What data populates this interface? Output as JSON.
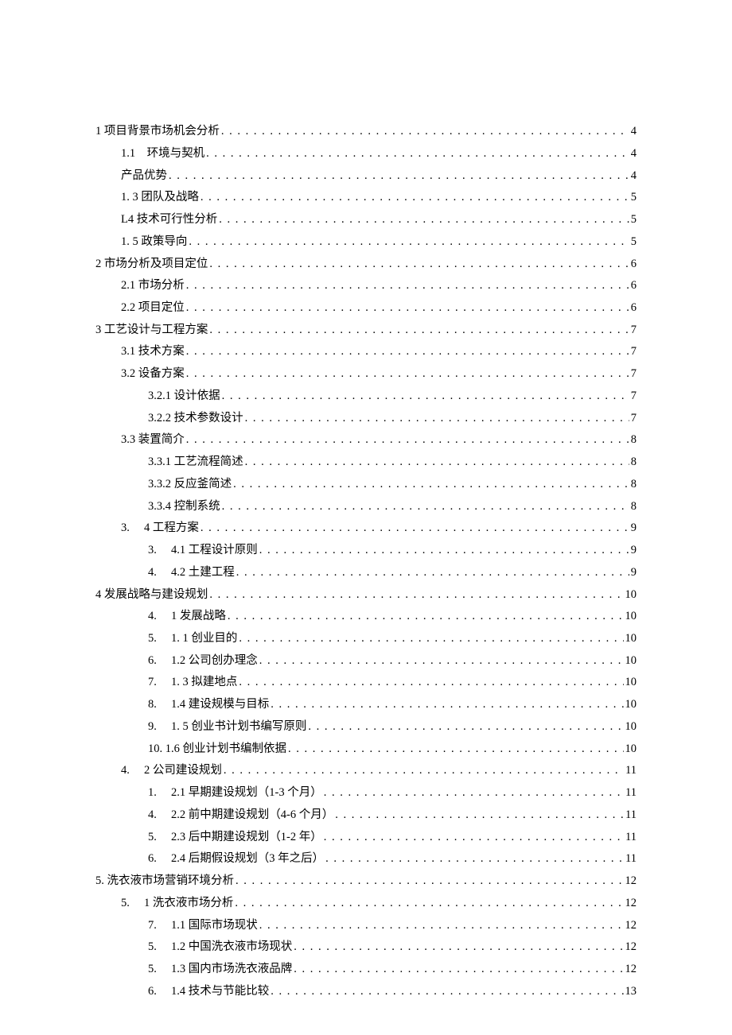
{
  "toc": [
    {
      "indent": 0,
      "label": "1 项目背景市场机会分析",
      "page": "4"
    },
    {
      "indent": 1,
      "label": "1.1　环境与契机",
      "page": "4"
    },
    {
      "indent": 1,
      "label": "产品优势",
      "page": "4"
    },
    {
      "indent": 1,
      "label": "1. 3 团队及战略",
      "page": "5"
    },
    {
      "indent": 1,
      "label": "L4 技术可行性分析",
      "page": "5"
    },
    {
      "indent": 1,
      "label": "1. 5 政策导向",
      "page": "5"
    },
    {
      "indent": 0,
      "label": "2 市场分析及项目定位",
      "page": "6"
    },
    {
      "indent": 1,
      "label": "2.1 市场分析",
      "page": "6"
    },
    {
      "indent": 1,
      "label": "2.2 项目定位",
      "page": "6"
    },
    {
      "indent": 0,
      "label": "3 工艺设计与工程方案",
      "page": "7"
    },
    {
      "indent": 1,
      "label": "3.1 技术方案",
      "page": "7"
    },
    {
      "indent": 1,
      "label": "3.2 设备方案",
      "page": "7"
    },
    {
      "indent": 2,
      "label": "3.2.1 设计依据",
      "page": "7"
    },
    {
      "indent": 2,
      "label": "3.2.2 技术参数设计",
      "page": "7"
    },
    {
      "indent": 1,
      "label": "3.3 装置简介",
      "page": "8"
    },
    {
      "indent": 2,
      "label": "3.3.1 工艺流程简述",
      "page": "8"
    },
    {
      "indent": 2,
      "label": "3.3.2 反应釜简述",
      "page": "8"
    },
    {
      "indent": 2,
      "label": "3.3.4 控制系统",
      "page": "8"
    },
    {
      "indent": 1,
      "label": "3.  4 工程方案",
      "page": "9"
    },
    {
      "indent": 2,
      "label": "3.  4.1 工程设计原则",
      "page": "9"
    },
    {
      "indent": 2,
      "label": "4.  4.2 土建工程",
      "page": "9"
    },
    {
      "indent": 0,
      "label": "4 发展战略与建设规划",
      "page": "10"
    },
    {
      "indent": 2,
      "label": "4.  1 发展战略",
      "page": "10"
    },
    {
      "indent": 2,
      "label": "5.  1. 1 创业目的",
      "page": "10"
    },
    {
      "indent": 2,
      "label": "6.  1.2 公司创办理念",
      "page": "10"
    },
    {
      "indent": 2,
      "label": "7.  1. 3 拟建地点",
      "page": "10"
    },
    {
      "indent": 2,
      "label": "8.  1.4 建设规模与目标",
      "page": "10"
    },
    {
      "indent": 2,
      "label": "9.  1. 5 创业书计划书编写原则",
      "page": "10"
    },
    {
      "indent": 2,
      "label": "10. 1.6 创业计划书编制依据",
      "page": "10"
    },
    {
      "indent": 1,
      "label": "4.  2 公司建设规划",
      "page": "11"
    },
    {
      "indent": 2,
      "label": "1.  2.1 早期建设规划（1-3 个月）",
      "page": "11"
    },
    {
      "indent": 2,
      "label": "4.  2.2 前中期建设规划（4-6 个月）",
      "page": "11"
    },
    {
      "indent": 2,
      "label": "5.  2.3 后中期建设规划（1-2 年）",
      "page": "11"
    },
    {
      "indent": 2,
      "label": "6.  2.4 后期假设规划（3 年之后）",
      "page": "11"
    },
    {
      "indent": 0,
      "label": "5. 洗衣液市场营销环境分析",
      "page": "12"
    },
    {
      "indent": 1,
      "label": "5.  1 洗衣液市场分析",
      "page": "12"
    },
    {
      "indent": 2,
      "label": "7.  1.1 国际市场现状",
      "page": "12"
    },
    {
      "indent": 2,
      "label": "5.  1.2 中国洗衣液市场现状",
      "page": "12"
    },
    {
      "indent": 2,
      "label": "5.  1.3 国内市场洗衣液品牌",
      "page": "12"
    },
    {
      "indent": 2,
      "label": "6.  1.4 技术与节能比较",
      "page": "13"
    }
  ]
}
